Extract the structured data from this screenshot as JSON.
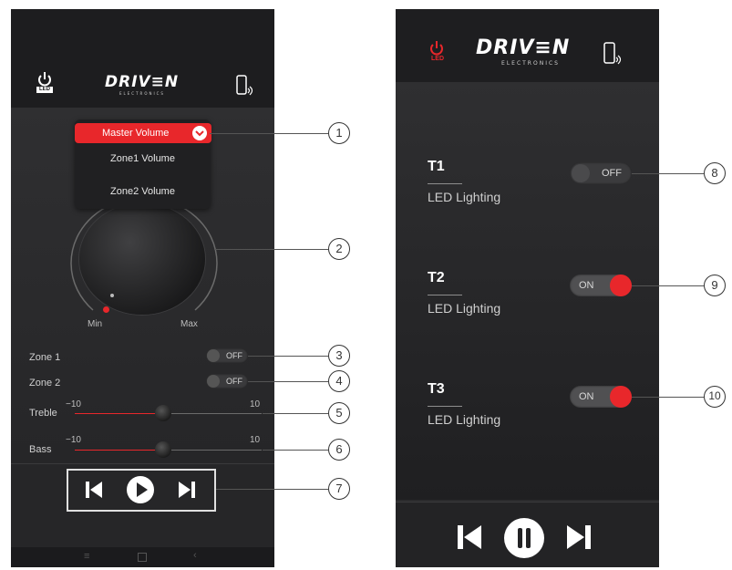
{
  "left_app": {
    "logo": {
      "brand": "DRIV≡N",
      "sub": "ELECTRONICS"
    },
    "led_icon_label": "LED",
    "volume_selector": {
      "selected": "Master Volume",
      "options": [
        "Zone1 Volume",
        "Zone2 Volume"
      ]
    },
    "knob": {
      "min_label": "Min",
      "max_label": "Max"
    },
    "zones": [
      {
        "label": "Zone 1",
        "state": "OFF"
      },
      {
        "label": "Zone 2",
        "state": "OFF"
      }
    ],
    "sliders": [
      {
        "label": "Treble",
        "min_label": "−10",
        "max_label": "10",
        "value": 0
      },
      {
        "label": "Bass",
        "min_label": "−10",
        "max_label": "10",
        "value": 0
      }
    ]
  },
  "right_app": {
    "logo": {
      "brand": "DRIV≡N",
      "sub": "ELECTRONICS"
    },
    "led_icon_label": "LED",
    "zones": [
      {
        "title": "T1",
        "subtitle": "LED Lighting",
        "state": "OFF"
      },
      {
        "title": "T2",
        "subtitle": "LED Lighting",
        "state": "ON"
      },
      {
        "title": "T3",
        "subtitle": "LED Lighting",
        "state": "ON"
      }
    ]
  },
  "callouts": [
    "1",
    "2",
    "3",
    "4",
    "5",
    "6",
    "7",
    "8",
    "9",
    "10"
  ],
  "colors": {
    "accent_red": "#e8272b",
    "panel_dark": "#2a2a2c"
  }
}
